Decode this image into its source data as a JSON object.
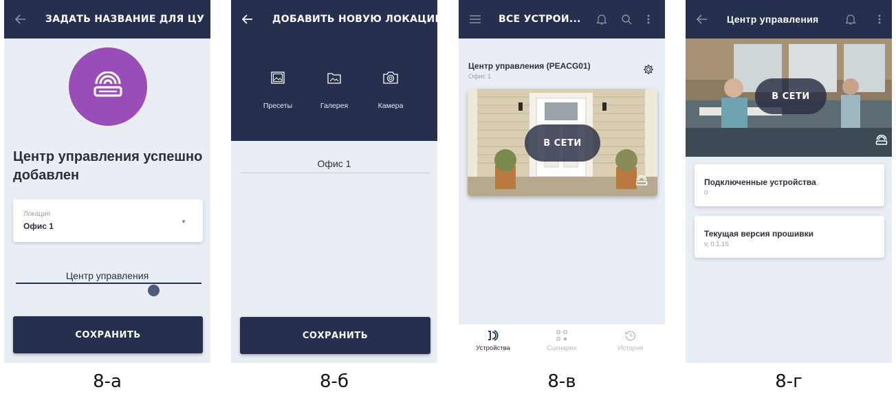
{
  "screen_a": {
    "appbar_title": "ЗАДАТЬ НАЗВАНИЕ ДЛЯ ЦУ",
    "success_title": "Центр управления успешно добавлен",
    "location_label": "Локация",
    "location_value": "Офис 1",
    "name_value": "Центр управления",
    "save_label": "СОХРАНИТЬ",
    "caption": "8-а",
    "accent_color": "#9a4cb8"
  },
  "screen_b": {
    "appbar_title": "ДОБАВИТЬ НОВУЮ ЛОКАЦИЮ",
    "sources": [
      {
        "label": "Пресеты",
        "icon": "image-icon"
      },
      {
        "label": "Галерея",
        "icon": "gallery-icon"
      },
      {
        "label": "Камера",
        "icon": "camera-icon"
      }
    ],
    "location_name": "Офис 1",
    "save_label": "СОХРАНИТЬ",
    "caption": "8-б"
  },
  "screen_c": {
    "appbar_title": "ВСЕ УСТРОЙ...",
    "hub_title": "Центр управления (PEACG01)",
    "hub_location": "Офис 1",
    "status": "В СЕТИ",
    "nav": [
      {
        "label": "Устройства",
        "icon": "devices-icon",
        "active": true
      },
      {
        "label": "Сценарии",
        "icon": "scenarios-icon",
        "active": false
      },
      {
        "label": "История",
        "icon": "history-icon",
        "active": false
      }
    ],
    "caption": "8-в"
  },
  "screen_d": {
    "appbar_title": "Центр управления",
    "status": "В СЕТИ",
    "cards": [
      {
        "title": "Подключенные устройства",
        "value": "0"
      },
      {
        "title": "Текущая версия прошивки",
        "value": "v. 0.1.15"
      }
    ],
    "caption": "8-г"
  },
  "colors": {
    "appbar": "#262f4d",
    "background": "#e9edf4",
    "muted_text": "#9aa0ab"
  }
}
